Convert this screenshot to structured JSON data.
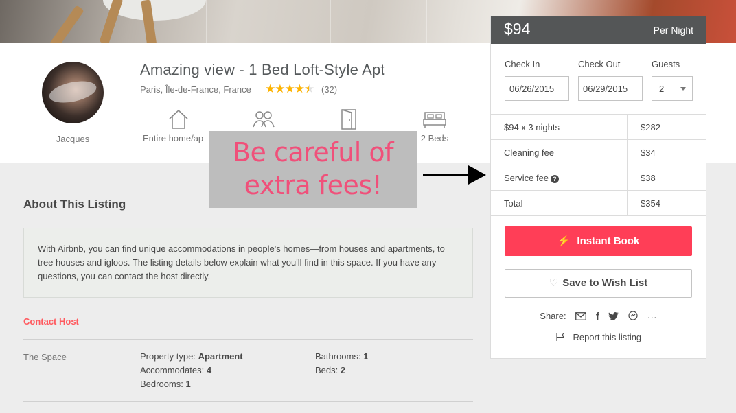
{
  "listing": {
    "title": "Amazing view - 1 Bed Loft-Style Apt",
    "location": "Paris, Île-de-France, France",
    "rating_stars": "★★★★★",
    "rating_value": 4.5,
    "review_count": "(32)",
    "host_name": "Jacques"
  },
  "features": [
    {
      "icon": "home-icon",
      "label": "Entire home/ap"
    },
    {
      "icon": "guests-icon",
      "label": ""
    },
    {
      "icon": "door-icon",
      "label": ""
    },
    {
      "icon": "bed-icon",
      "label": "2 Beds"
    }
  ],
  "annotation": {
    "line1": "Be careful of",
    "line2": "extra fees!"
  },
  "about": {
    "title": "About This Listing",
    "description": "With Airbnb, you can find unique accommodations in people's homes—from houses and apartments, to tree houses and igloos. The listing details below explain what you'll find in this space. If you have any questions, you can contact the host directly.",
    "contact_host": "Contact Host",
    "space_label": "The Space",
    "specs_left": [
      {
        "key": "Property type:",
        "value": "Apartment"
      },
      {
        "key": "Accommodates:",
        "value": "4"
      },
      {
        "key": "Bedrooms:",
        "value": "1"
      }
    ],
    "specs_right": [
      {
        "key": "Bathrooms:",
        "value": "1"
      },
      {
        "key": "Beds:",
        "value": "2"
      }
    ]
  },
  "booking": {
    "price": "$94",
    "per_night": "Per Night",
    "check_in_label": "Check In",
    "check_out_label": "Check Out",
    "guests_label": "Guests",
    "check_in_value": "06/26/2015",
    "check_out_value": "06/29/2015",
    "guests_value": "2",
    "fees": [
      {
        "label": "$94 x 3 nights",
        "value": "$282"
      },
      {
        "label": "Cleaning fee",
        "value": "$34"
      },
      {
        "label": "Service fee",
        "value": "$38"
      },
      {
        "label": "Total",
        "value": "$354"
      }
    ],
    "instant_book": "Instant Book",
    "save_wish": "Save to Wish List",
    "share_label": "Share:",
    "share_icons": [
      "email-icon",
      "facebook-icon",
      "twitter-icon",
      "messenger-icon",
      "more-icon"
    ],
    "report": "Report this listing"
  },
  "colors": {
    "accent": "#ff3e57",
    "link": "#ff5a5f",
    "star": "#ffb400",
    "annotation_text": "#f0507a",
    "annotation_bg": "#bdbdbd"
  }
}
